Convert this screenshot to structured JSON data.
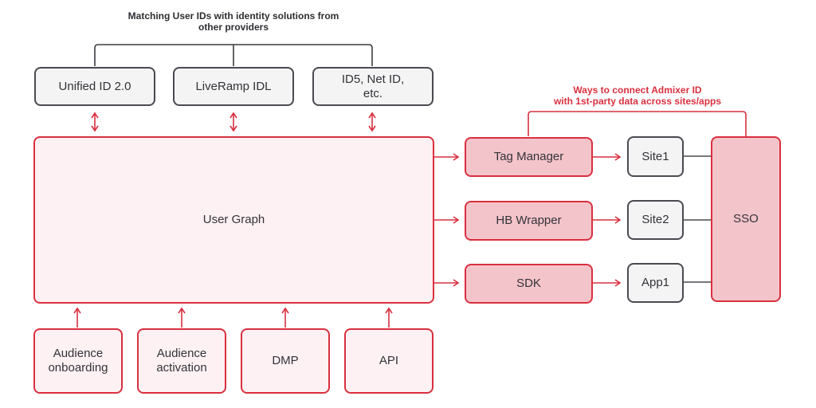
{
  "top_caption": "Matching User IDs with identity solutions from\nother providers",
  "right_caption": "Ways to connect Admixer ID\nwith 1st-party data across sites/apps",
  "identity_providers": [
    {
      "label": "Unified ID 2.0"
    },
    {
      "label": "LiveRamp IDL"
    },
    {
      "label": "ID5, Net ID,\netc."
    }
  ],
  "core": {
    "label": "User Graph"
  },
  "inputs": [
    {
      "label": "Audience\nonboarding"
    },
    {
      "label": "Audience\nactivation"
    },
    {
      "label": "DMP"
    },
    {
      "label": "API"
    }
  ],
  "connectors": [
    {
      "label": "Tag Manager"
    },
    {
      "label": "HB Wrapper"
    },
    {
      "label": "SDK"
    }
  ],
  "properties": [
    {
      "label": "Site1"
    },
    {
      "label": "Site2"
    },
    {
      "label": "App1"
    }
  ],
  "sso": {
    "label": "SSO"
  },
  "colors": {
    "accent_red": "#d9303f",
    "pink_fill": "#f4c4cb",
    "light_pink_fill": "#fdf1f3",
    "gray_fill": "#f4f4f5",
    "dark_border": "#4a4a50"
  }
}
